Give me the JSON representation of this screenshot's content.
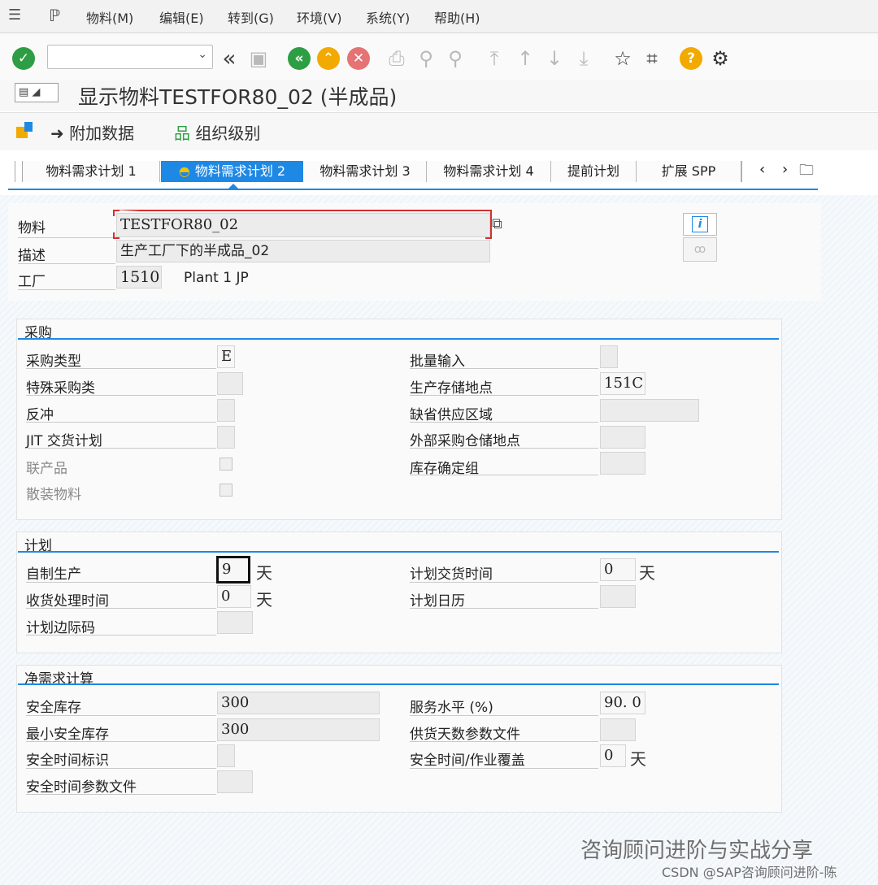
{
  "menu": {
    "items": [
      "物料(M)",
      "编辑(E)",
      "转到(G)",
      "环境(V)",
      "系统(Y)",
      "帮助(H)"
    ]
  },
  "toolbar": {
    "command_value": "",
    "icons": [
      "check-icon",
      "back-double-icon",
      "save-icon",
      "back-icon",
      "exit-icon",
      "cancel-icon",
      "print-icon",
      "find-icon",
      "find-next-icon",
      "first-page-icon",
      "prev-page-icon",
      "next-page-icon",
      "last-page-icon",
      "create-session-icon",
      "shortcut-icon",
      "help-icon",
      "settings-icon"
    ]
  },
  "title": "显示物料TESTFOR80_02 (半成品)",
  "app_toolbar": {
    "additional_data": "附加数据",
    "org_levels": "组织级别"
  },
  "tabs": [
    "物料需求计划 1",
    "物料需求计划 2",
    "物料需求计划 3",
    "物料需求计划 4",
    "提前计划",
    "扩展 SPP"
  ],
  "active_tab_index": 1,
  "header": {
    "material_label": "物料",
    "material_value": "TESTFOR80_02",
    "description_label": "描述",
    "description_value": "生产工厂下的半成品_02",
    "plant_label": "工厂",
    "plant_value": "1510",
    "plant_name": "Plant 1 JP"
  },
  "procurement": {
    "title": "采购",
    "procurement_type_label": "采购类型",
    "procurement_type_value": "E",
    "special_procurement_label": "特殊采购类",
    "special_procurement_value": "",
    "backflush_label": "反冲",
    "backflush_value": "",
    "jit_label": "JIT 交货计划",
    "jit_value": "",
    "coproduct_label": "联产品",
    "bulk_material_label": "散装物料",
    "batch_entry_label": "批量输入",
    "batch_entry_value": "",
    "prod_storage_label": "生产存储地点",
    "prod_storage_value": "151C",
    "default_supply_area_label": "缺省供应区域",
    "default_supply_area_value": "",
    "ext_proc_storage_label": "外部采购仓储地点",
    "ext_proc_storage_value": "",
    "stock_det_group_label": "库存确定组",
    "stock_det_group_value": ""
  },
  "planning": {
    "title": "计划",
    "inhouse_prod_label": "自制生产",
    "inhouse_prod_value": "9",
    "gr_processing_label": "收货处理时间",
    "gr_processing_value": "0",
    "sm_key_label": "计划边际码",
    "sm_key_value": "",
    "planned_delivery_label": "计划交货时间",
    "planned_delivery_value": "0",
    "planning_calendar_label": "计划日历",
    "planning_calendar_value": "",
    "day_unit": "天"
  },
  "net_requirements": {
    "title": "净需求计算",
    "safety_stock_label": "安全库存",
    "safety_stock_value": "300",
    "min_safety_stock_label": "最小安全库存",
    "min_safety_stock_value": "300",
    "safety_time_ind_label": "安全时间标识",
    "safety_time_ind_value": "",
    "safety_time_profile_label": "安全时间参数文件",
    "safety_time_profile_value": "",
    "service_level_label": "服务水平 (%)",
    "service_level_value": "90. 0",
    "coverage_profile_label": "供货天数参数文件",
    "coverage_profile_value": "",
    "safety_time_act_label": "安全时间/作业覆盖",
    "safety_time_act_value": "0",
    "day_unit": "天"
  },
  "watermark": {
    "line1": "咨询顾问进阶与实战分享",
    "line2": "CSDN @SAP咨询顾问进阶-陈"
  },
  "colors": {
    "accent": "#1e88e5",
    "check_green": "#2e9e45",
    "back_green": "#2e9e45",
    "exit_orange": "#f2a900",
    "cancel_red": "#e57373",
    "help_orange": "#f2a900"
  }
}
